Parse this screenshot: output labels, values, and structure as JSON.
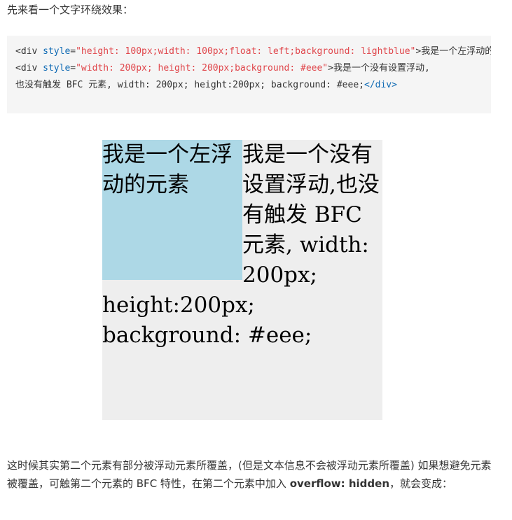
{
  "intro": {
    "text": "先来看一个文字环绕效果："
  },
  "code": {
    "line1": {
      "open": "<",
      "tag": "div",
      "attr": "style",
      "eq": "=",
      "value": "\"height: 100px;width: 100px;float: left;background: lightblue\"",
      "close": ">",
      "text": "我是一个左浮动的元素</div>"
    },
    "line2": {
      "open": "<",
      "tag": "div",
      "attr": "style",
      "eq": "=",
      "value": "\"width: 200px; height: 200px;background: #eee\"",
      "close": ">",
      "text": "我是一个没有设置浮动,"
    },
    "line3": {
      "text": "也没有触发 BFC 元素, width: 200px; height:200px; background: #eee;",
      "end_tag": "</div>"
    },
    "scrollbar": {
      "left_arrow": "◀",
      "right_arrow": "▶"
    }
  },
  "demo": {
    "float_text": "我是一个左浮动的元素",
    "main_text": "我是一个没有设置浮动,也没有触发 BFC 元素, width: 200px; height:200px; background: #eee;"
  },
  "paragraph": {
    "part1": "这时候其实第二个元素有部分被浮动元素所覆盖，(但是文本信息不会被浮动元素所覆盖) 如果想避免元素被覆盖，可触第二个元素的 BFC 特性，在第二个元素中加入 ",
    "bold1": "overflow: hidden",
    "part2": "，就会变成："
  },
  "colors": {
    "float_bg": "lightblue",
    "box_bg": "#eee",
    "code_bg": "#f5f5f5"
  }
}
